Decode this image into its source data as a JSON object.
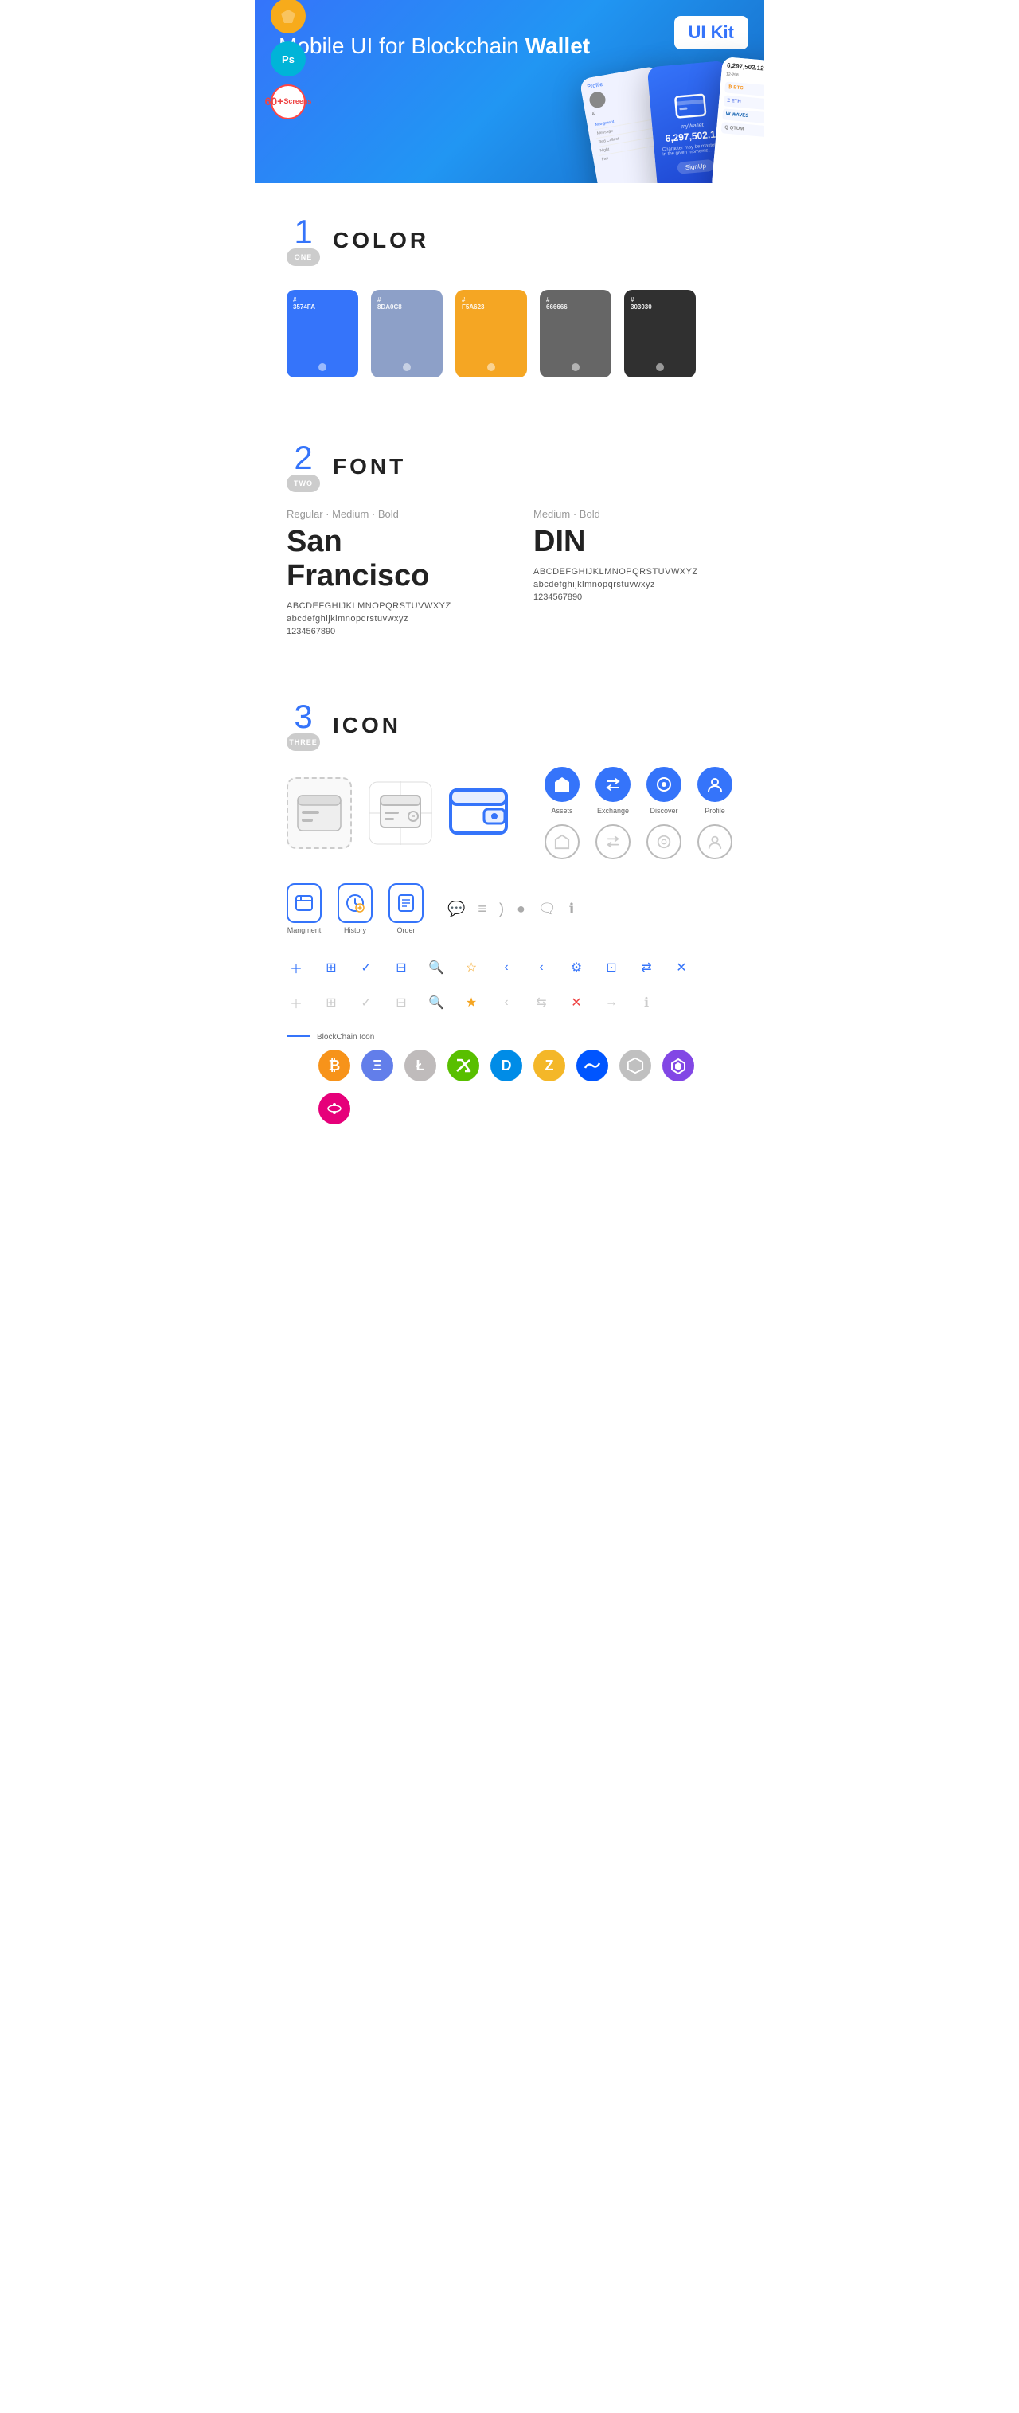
{
  "hero": {
    "title": "Mobile UI for Blockchain ",
    "title_bold": "Wallet",
    "badge": "UI Kit",
    "badge_sketch": "S",
    "badge_ps": "Ps",
    "badge_count": "60+",
    "badge_count_sub": "Screens"
  },
  "section1": {
    "num": "1",
    "label": "ONE",
    "title": "COLOR",
    "colors": [
      {
        "hex": "#3574FA",
        "label": "3574FA"
      },
      {
        "hex": "#8DA0C8",
        "label": "8DA0C8"
      },
      {
        "hex": "#F5A623",
        "label": "F5A623"
      },
      {
        "hex": "#666666",
        "label": "666666"
      },
      {
        "hex": "#303030",
        "label": "303030"
      }
    ]
  },
  "section2": {
    "num": "2",
    "label": "TWO",
    "title": "FONT",
    "font1": {
      "styles": "Regular · Medium · Bold",
      "name": "San Francisco",
      "upper": "ABCDEFGHIJKLMNOPQRSTUVWXYZ",
      "lower": "abcdefghijklmnopqrstuvwxyz",
      "numbers": "1234567890"
    },
    "font2": {
      "styles": "Medium · Bold",
      "name": "DIN",
      "upper": "ABCDEFGHIJKLMNOPQRSTUVWXYZ",
      "lower": "abcdefghijklmnopqrstuvwxyz",
      "numbers": "1234567890"
    }
  },
  "section3": {
    "num": "3",
    "label": "THREE",
    "title": "ICON",
    "named_icons": [
      {
        "icon": "◆",
        "label": "Assets"
      },
      {
        "icon": "♻",
        "label": "Exchange"
      },
      {
        "icon": "●",
        "label": "Discover"
      },
      {
        "icon": "👤",
        "label": "Profile"
      }
    ],
    "app_icons": [
      {
        "icon": "☰",
        "label": "Mangment"
      },
      {
        "icon": "⊙",
        "label": "History"
      },
      {
        "icon": "≡",
        "label": "Order"
      }
    ],
    "small_icons_row1": [
      "+",
      "⊞",
      "✓",
      "⊟",
      "🔍",
      "☆",
      "‹",
      "‹",
      "⚙",
      "⊡",
      "⇄",
      "✕"
    ],
    "blockchain_label": "BlockChain Icon",
    "crypto_icons": [
      {
        "symbol": "₿",
        "name": "Bitcoin",
        "bg": "#F7931A"
      },
      {
        "symbol": "Ξ",
        "name": "Ethereum",
        "bg": "#627EEA"
      },
      {
        "symbol": "Ł",
        "name": "Litecoin",
        "bg": "#BFBBBB"
      },
      {
        "symbol": "N",
        "name": "NEO",
        "bg": "#58BF00"
      },
      {
        "symbol": "D",
        "name": "Dash",
        "bg": "#008CE7"
      },
      {
        "symbol": "Z",
        "name": "Zcash",
        "bg": "#F4B728"
      },
      {
        "symbol": "W",
        "name": "Waves",
        "bg": "#0155FF"
      },
      {
        "symbol": "⬡",
        "name": "Ethereum2",
        "bg": "#8A92B2"
      },
      {
        "symbol": "◈",
        "name": "Matic",
        "bg": "#8247E5"
      },
      {
        "symbol": "•",
        "name": "Polkadot",
        "bg": "#E6007A"
      }
    ]
  }
}
